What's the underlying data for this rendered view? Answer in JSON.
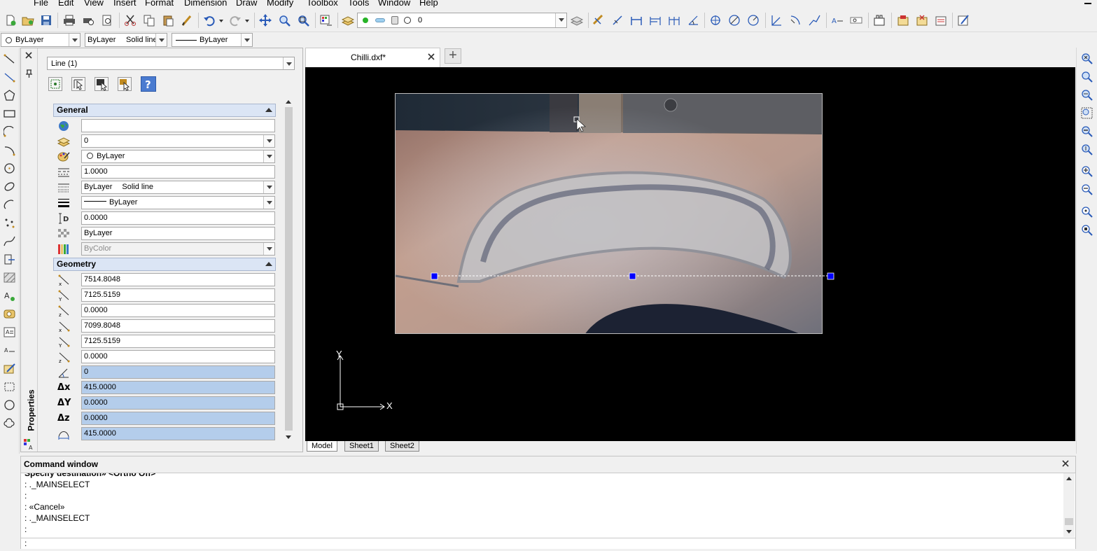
{
  "menu": [
    "File",
    "Edit",
    "View",
    "Insert",
    "Format",
    "Dimension",
    "Draw",
    "Modify",
    "Toolbox",
    "Tools",
    "Window",
    "Help"
  ],
  "toolbar": {
    "layer_combo": "0",
    "color_combo": "ByLayer",
    "linetype_combo": "ByLayer",
    "linetype_combo_sub": "Solid line",
    "lineweight_combo": "ByLayer"
  },
  "properties": {
    "panel_title": "Properties",
    "entity_select": "Line (1)",
    "general": {
      "header": "General",
      "hyperlink": "",
      "layer": "0",
      "color": "ByLayer",
      "linetype_scale": "1.0000",
      "linetype": "ByLayer",
      "linetype_sub": "Solid line",
      "lineweight": "ByLayer",
      "thickness": "0.0000",
      "transparency": "ByLayer",
      "plot_style": "ByColor"
    },
    "geometry": {
      "header": "Geometry",
      "start_x": "7514.8048",
      "start_y": "7125.5159",
      "start_z": "0.0000",
      "end_x": "7099.8048",
      "end_y": "7125.5159",
      "end_z": "0.0000",
      "angle": "0",
      "delta_x": "415.0000",
      "delta_y": "0.0000",
      "delta_z": "0.0000",
      "length": "415.0000"
    },
    "labels": {
      "dx": "Δx",
      "dy": "ΔY",
      "dz": "Δz",
      "d": "D",
      "x": "x",
      "y": "Y",
      "z": "z"
    }
  },
  "document": {
    "tab_label": "Chilli.dxf*",
    "add_tab": "+",
    "ucs_x": "X",
    "ucs_y": "Y"
  },
  "sheet_tabs": [
    "Model",
    "Sheet1",
    "Sheet2"
  ],
  "command_window": {
    "title": "Command window",
    "lines": [
      "Specify destination» <Ortho Off>",
      ": ._MAINSELECT",
      ":",
      ": «Cancel»",
      ": ._MAINSELECT",
      ":"
    ],
    "prompt": ":"
  },
  "colors": {
    "grip": "#0000ff",
    "canvas": "#000000",
    "selected_field": "#b4cdeb",
    "section_header": "#dbe5f5"
  }
}
